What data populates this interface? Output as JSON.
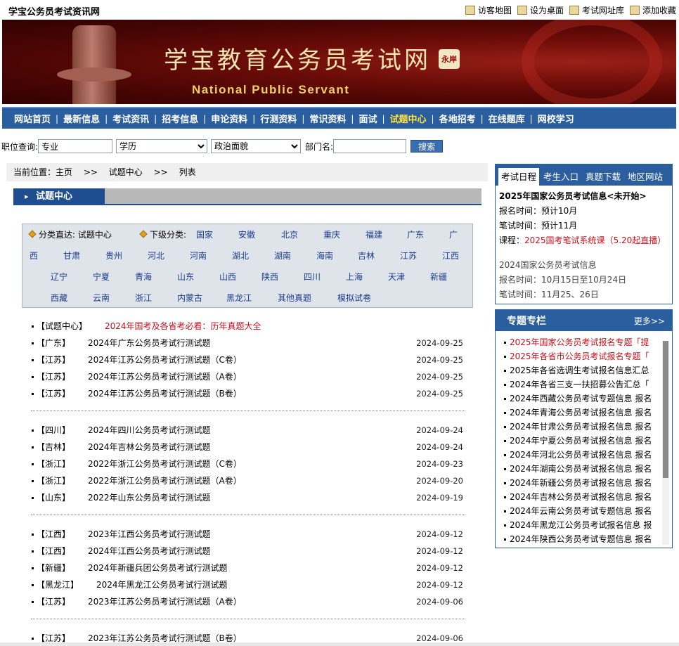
{
  "topbar": {
    "site_name": "学宝公务员考试资讯网",
    "links": [
      "访客地图",
      "设为桌面",
      "考试网址库",
      "添加收藏"
    ]
  },
  "banner": {
    "title": "学宝教育公务员考试网",
    "seal": "永岸",
    "subtitle": "National Public Servant"
  },
  "nav": {
    "items": [
      "网站首页",
      "最新信息",
      "考试资讯",
      "招考信息",
      "申论资料",
      "行测资料",
      "常识资料",
      "面试",
      "试题中心",
      "各地招考",
      "在线题库",
      "网校学习"
    ],
    "active_index": 8
  },
  "search": {
    "job_label": "职位查询:",
    "major_value": "专业",
    "education_value": "学历",
    "politics_value": "政治面貌",
    "dept_label": "部门名:",
    "dept_value": "",
    "button": "搜索"
  },
  "breadcrumb": {
    "prefix": "当前位置：主页",
    "sep": ">>",
    "level1": "试题中心",
    "level2": "列表"
  },
  "section": {
    "title": "试题中心"
  },
  "categories": {
    "direct_label": "分类直达: 试题中心",
    "sub_label": "下级分类:",
    "items": [
      "国家",
      "安徽",
      "北京",
      "重庆",
      "福建",
      "广东",
      "广西",
      "甘肃",
      "贵州",
      "河北",
      "河南",
      "湖北",
      "湖南",
      "海南",
      "吉林",
      "江苏",
      "江西",
      "辽宁",
      "宁夏",
      "青海",
      "山东",
      "山西",
      "陕西",
      "四川",
      "上海",
      "天津",
      "新疆",
      "西藏",
      "云南",
      "浙江",
      "内蒙古",
      "黑龙江",
      "其他真题",
      "模拟试卷"
    ]
  },
  "list": {
    "featured": {
      "tag": "【试题中心】",
      "title": "2024年国考及各省考必看：历年真题大全"
    },
    "groups": [
      [
        {
          "tag": "【广东】",
          "title": "2024年广东公务员考试行测试题",
          "date": "2024-09-25"
        },
        {
          "tag": "【江苏】",
          "title": "2024年江苏公务员考试行测试题（C卷）",
          "date": "2024-09-25"
        },
        {
          "tag": "【江苏】",
          "title": "2024年江苏公务员考试行测试题（A卷）",
          "date": "2024-09-25"
        },
        {
          "tag": "【江苏】",
          "title": "2024年江苏公务员考试行测试题（B卷）",
          "date": "2024-09-25"
        }
      ],
      [
        {
          "tag": "【四川】",
          "title": "2024年四川公务员考试行测试题",
          "date": "2024-09-24"
        },
        {
          "tag": "【吉林】",
          "title": "2024年吉林公务员考试行测试题",
          "date": "2024-09-24"
        },
        {
          "tag": "【浙江】",
          "title": "2022年浙江公务员考试行测试题（C卷）",
          "date": "2024-09-23"
        },
        {
          "tag": "【浙江】",
          "title": "2022年浙江公务员考试行测试题（A卷）",
          "date": "2024-09-20"
        },
        {
          "tag": "【山东】",
          "title": "2022年山东公务员考试行测试题",
          "date": "2024-09-19"
        }
      ],
      [
        {
          "tag": "【江西】",
          "title": "2023年江西公务员考试行测试题",
          "date": "2024-09-12"
        },
        {
          "tag": "【江西】",
          "title": "2024年江西公务员考试行测试题",
          "date": "2024-09-12"
        },
        {
          "tag": "【新疆】",
          "title": "2024年新疆兵团公务员考试行测试题",
          "date": "2024-09-12"
        },
        {
          "tag": "【黑龙江】",
          "title": "2024年黑龙江公务员考试行测试题",
          "date": "2024-09-12"
        },
        {
          "tag": "【江苏】",
          "title": "2023年江苏公务员考试行测试题（A卷）",
          "date": "2024-09-06"
        }
      ],
      [
        {
          "tag": "【江苏】",
          "title": "2023年江苏公务员考试行测试题（B卷）",
          "date": "2024-09-06"
        }
      ]
    ]
  },
  "infobox": {
    "tabs": [
      "考试日程",
      "考生入口",
      "真题下载",
      "地区网站"
    ],
    "active_tab": 0,
    "headline": "2025年国家公务员考试信息<未开始>",
    "reg_time": "报名时间：预计10月",
    "exam_time": "笔试时间：预计11月",
    "course_label": "课程：",
    "course_link": "2025国考笔试系统课（5.20起直播）",
    "prev_headline": "2024国家公务员考试信息",
    "prev_reg": "报名时间：10月15日至10月24日",
    "prev_exam": "笔试时间：11月25、26日"
  },
  "special": {
    "title": "专题专栏",
    "more": "更多>>",
    "items": [
      {
        "text": "2025年国家公务员考试报名专题「提",
        "red": true
      },
      {
        "text": "2025年各省市公务员考试报名专题「",
        "red": true
      },
      {
        "text": "2025年各省选调生考试报名信息汇总",
        "red": false
      },
      {
        "text": "2024年各省三支一扶招募公告汇总「",
        "red": false
      },
      {
        "text": "2024年西藏公务员考试专题信息 报名",
        "red": false
      },
      {
        "text": "2024年青海公务员考试报名信息 报名",
        "red": false
      },
      {
        "text": "2024年甘肃公务员考试报名信息 报名",
        "red": false
      },
      {
        "text": "2024年宁夏公务员考试报名信息 报名",
        "red": false
      },
      {
        "text": "2024年河北公务员考试报名信息 报名",
        "red": false
      },
      {
        "text": "2024年湖南公务员考试报名信息 报名",
        "red": false
      },
      {
        "text": "2024年新疆公务员考试报名信息 报名",
        "red": false
      },
      {
        "text": "2024年吉林公务员考试报名信息 报名",
        "red": false
      },
      {
        "text": "2024年云南公务员考试专题信息 报名",
        "red": false
      },
      {
        "text": "2024年黑龙江公务员考试报名信息 报",
        "red": false
      },
      {
        "text": "2024年陕西公务员考试专题信息 报名",
        "red": false
      }
    ]
  },
  "colors": {
    "nav_bg": "#2a5e9e",
    "nav_active": "#ffe23a",
    "accent_red": "#c8101a",
    "banner_bg": "#5a0806"
  }
}
